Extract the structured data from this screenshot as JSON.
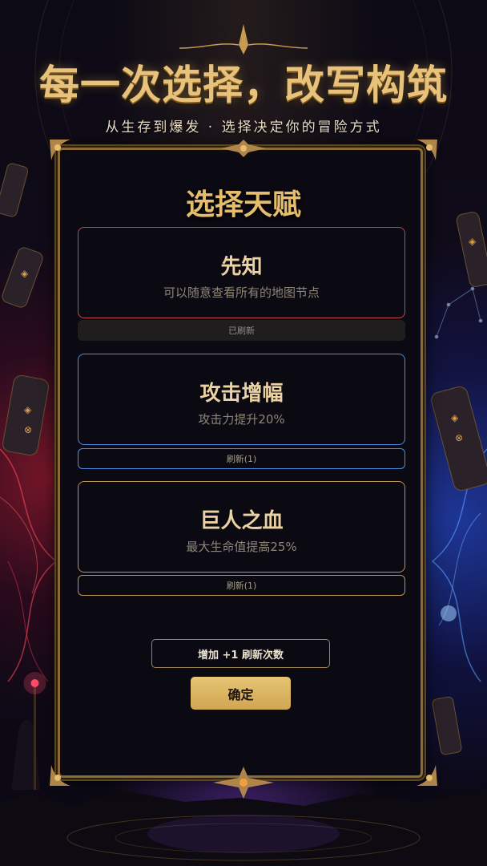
{
  "header": {
    "headline": "每一次选择，改写构筑",
    "subline": "从生存到爆发 · 选择决定你的冒险方式"
  },
  "panel": {
    "title": "选择天赋"
  },
  "talents": [
    {
      "name": "先知",
      "description": "可以随意查看所有的地图节点",
      "refresh_label": "已刷新",
      "accent": "#c8484a"
    },
    {
      "name": "攻击增幅",
      "description": "攻击力提升20%",
      "refresh_label": "刷新(1)",
      "accent": "#4f8ee0"
    },
    {
      "name": "巨人之血",
      "description": "最大生命值提高25%",
      "refresh_label": "刷新(1)",
      "accent": "#b89550"
    }
  ],
  "actions": {
    "add_refresh_label": "增加 +1 刷新次数",
    "confirm_label": "确定"
  },
  "colors": {
    "gold": "#e6bd6c",
    "red_glow": "#c8484a",
    "blue_glow": "#4f8ee0"
  }
}
